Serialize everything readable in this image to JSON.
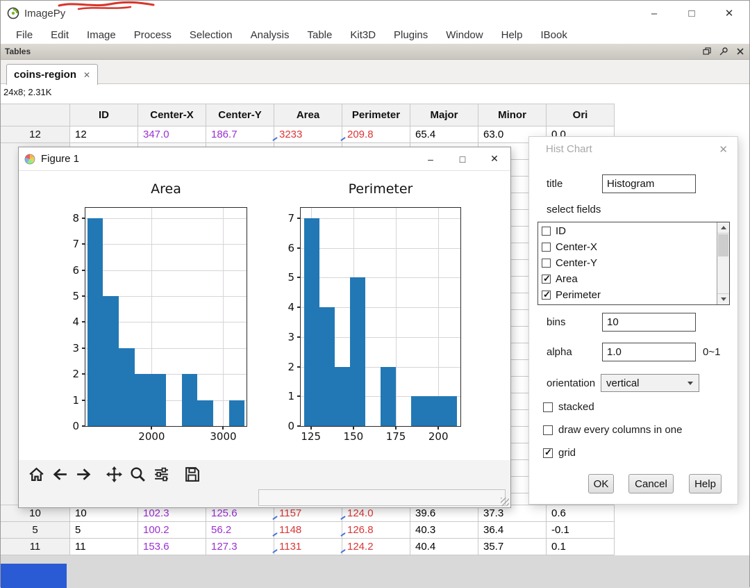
{
  "app": {
    "title": "ImagePy",
    "window_controls": {
      "minimize": "–",
      "maximize": "□",
      "close": "✕"
    }
  },
  "menubar": {
    "items": [
      "File",
      "Edit",
      "Image",
      "Process",
      "Selection",
      "Analysis",
      "Table",
      "Kit3D",
      "Plugins",
      "Window",
      "Help",
      "IBook"
    ]
  },
  "tables_panel": {
    "caption": "Tables",
    "icons": [
      "float-icon",
      "pin-icon",
      "close-icon"
    ],
    "tab_label": "coins-region",
    "tab_close": "✕",
    "summary": "24x8; 2.31K"
  },
  "table": {
    "columns": [
      "ID",
      "Center-X",
      "Center-Y",
      "Area",
      "Perimeter",
      "Major",
      "Minor",
      "Ori"
    ],
    "column_colors": [
      "#000000",
      "#9a2fd2",
      "#9a2fd2",
      "#d93636",
      "#d93636",
      "#000000",
      "#000000",
      "#000000"
    ],
    "marked_columns": [
      3,
      4
    ],
    "mark_color": "#4a72d8",
    "visible_rows_top": [
      {
        "index": "12",
        "cells": [
          "12",
          "347.0",
          "186.7",
          "3233",
          "209.8",
          "65.4",
          "63.0",
          "0.0"
        ]
      }
    ],
    "visible_rows_bottom": [
      {
        "index": "10",
        "cells": [
          "10",
          "102.3",
          "125.6",
          "1157",
          "124.0",
          "39.6",
          "37.3",
          "0.6"
        ]
      },
      {
        "index": "5",
        "cells": [
          "5",
          "100.2",
          "56.2",
          "1148",
          "126.8",
          "40.3",
          "36.4",
          "-0.1"
        ]
      },
      {
        "index": "11",
        "cells": [
          "11",
          "153.6",
          "127.3",
          "1131",
          "124.2",
          "40.4",
          "35.7",
          "0.1"
        ]
      }
    ]
  },
  "figure_window": {
    "title": "Figure 1",
    "window_controls": {
      "minimize": "–",
      "maximize": "□",
      "close": "✕"
    },
    "toolbar_icons": [
      "home-icon",
      "back-icon",
      "forward-icon",
      "pan-icon",
      "zoom-icon",
      "sliders-icon",
      "save-icon"
    ]
  },
  "chart_data": [
    {
      "type": "histogram",
      "title": "Area",
      "bin_start": 1100,
      "bin_width": 220,
      "counts": [
        8,
        5,
        3,
        2,
        2,
        0,
        2,
        1,
        0,
        1
      ],
      "xticks": [
        2000,
        3000
      ],
      "yticks": [
        0,
        1,
        2,
        3,
        4,
        5,
        6,
        7,
        8
      ],
      "xlim": [
        1075,
        3325
      ],
      "ylim": [
        0,
        8.4
      ],
      "bar_color": "#2278b5",
      "grid": true
    },
    {
      "type": "histogram",
      "title": "Perimeter",
      "bin_start": 121,
      "bin_width": 9,
      "counts": [
        7,
        4,
        2,
        5,
        0,
        2,
        0,
        1,
        1,
        1
      ],
      "xticks": [
        125,
        150,
        175,
        200
      ],
      "yticks": [
        0,
        1,
        2,
        3,
        4,
        5,
        6,
        7
      ],
      "xlim": [
        119,
        213
      ],
      "ylim": [
        0,
        7.35
      ],
      "bar_color": "#2278b5",
      "grid": true
    }
  ],
  "dialog": {
    "title": "Hist Chart",
    "close": "✕",
    "title_field": {
      "label": "title",
      "value": "Histogram"
    },
    "select_fields_label": "select fields",
    "field_options": [
      {
        "label": "ID",
        "checked": false
      },
      {
        "label": "Center-X",
        "checked": false
      },
      {
        "label": "Center-Y",
        "checked": false
      },
      {
        "label": "Area",
        "checked": true
      },
      {
        "label": "Perimeter",
        "checked": true
      }
    ],
    "bins_field": {
      "label": "bins",
      "value": "10"
    },
    "alpha_field": {
      "label": "alpha",
      "value": "1.0",
      "hint": "0~1"
    },
    "orientation_field": {
      "label": "orientation",
      "value": "vertical"
    },
    "stacked_option": {
      "label": "stacked",
      "checked": false
    },
    "draw_every_option": {
      "label": "draw every columns in one",
      "checked": false
    },
    "grid_option": {
      "label": "grid",
      "checked": true
    },
    "buttons": {
      "ok": "OK",
      "cancel": "Cancel",
      "help": "Help"
    }
  }
}
